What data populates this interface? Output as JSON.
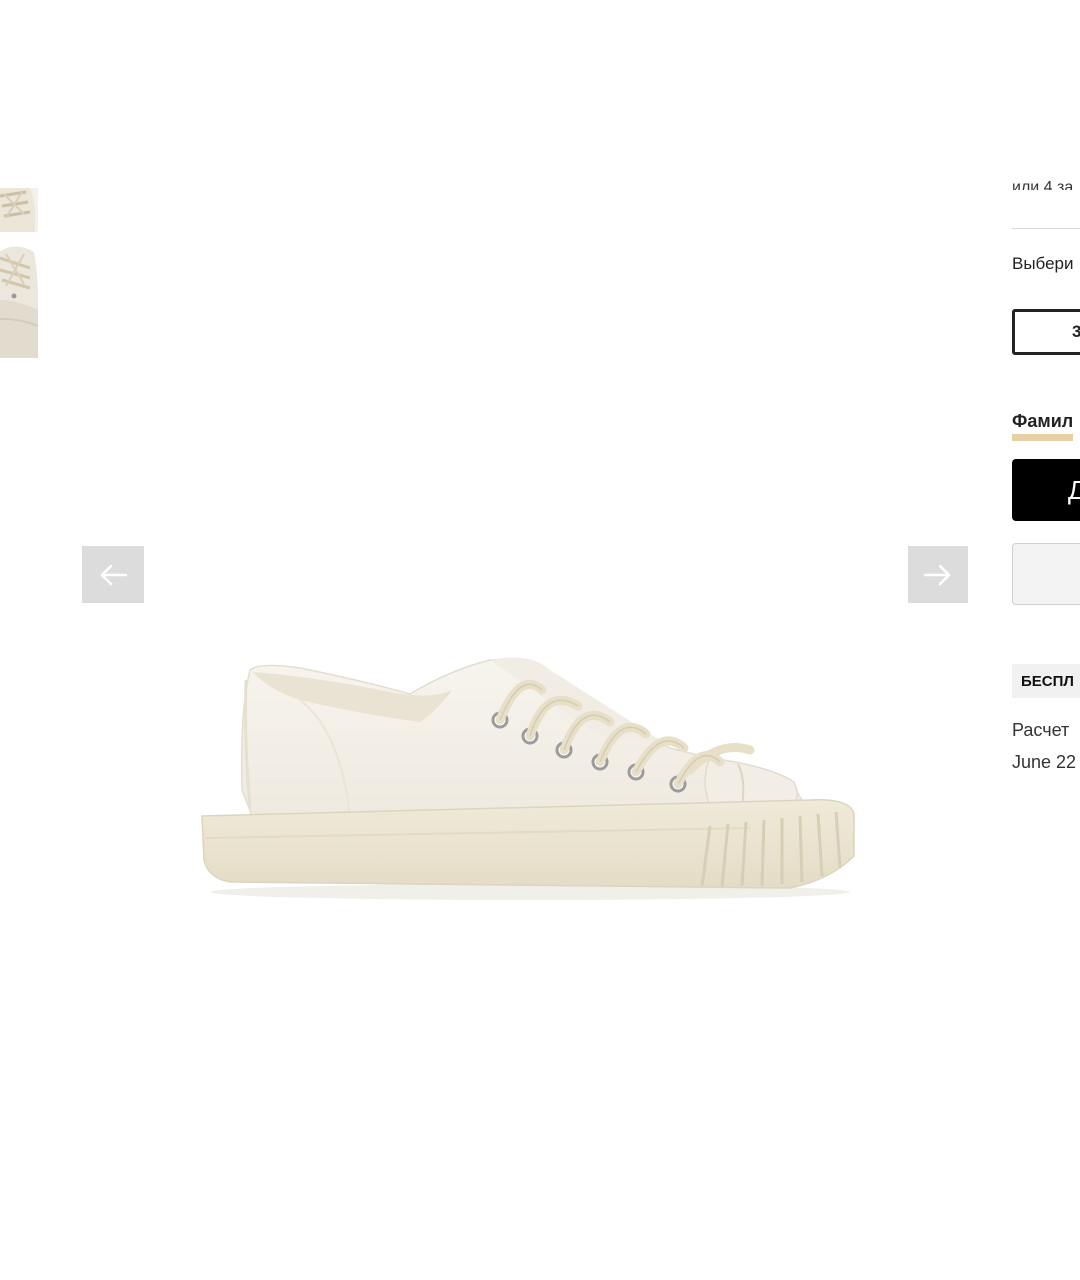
{
  "gallery": {
    "thumbnails": [
      "sneaker-top-view",
      "sneaker-front-view"
    ],
    "main_image": "white-canvas-low-top-sneaker",
    "prev_icon": "arrow-left-icon",
    "next_icon": "arrow-right-icon"
  },
  "product_panel": {
    "installment_text": "или 4 за",
    "size_prompt": "Выбери",
    "size_option": "3",
    "family_label": "Фамил",
    "primary_button_label": "Д",
    "secondary_button_label": "",
    "shipping_badge": "БЕСПЛ",
    "estimate_text": "Расчет",
    "estimate_date": "June 22"
  },
  "colors": {
    "accent_underline": "#e8cfa6",
    "primary_button": "#000000",
    "nav_button": "#dcdcdc"
  }
}
